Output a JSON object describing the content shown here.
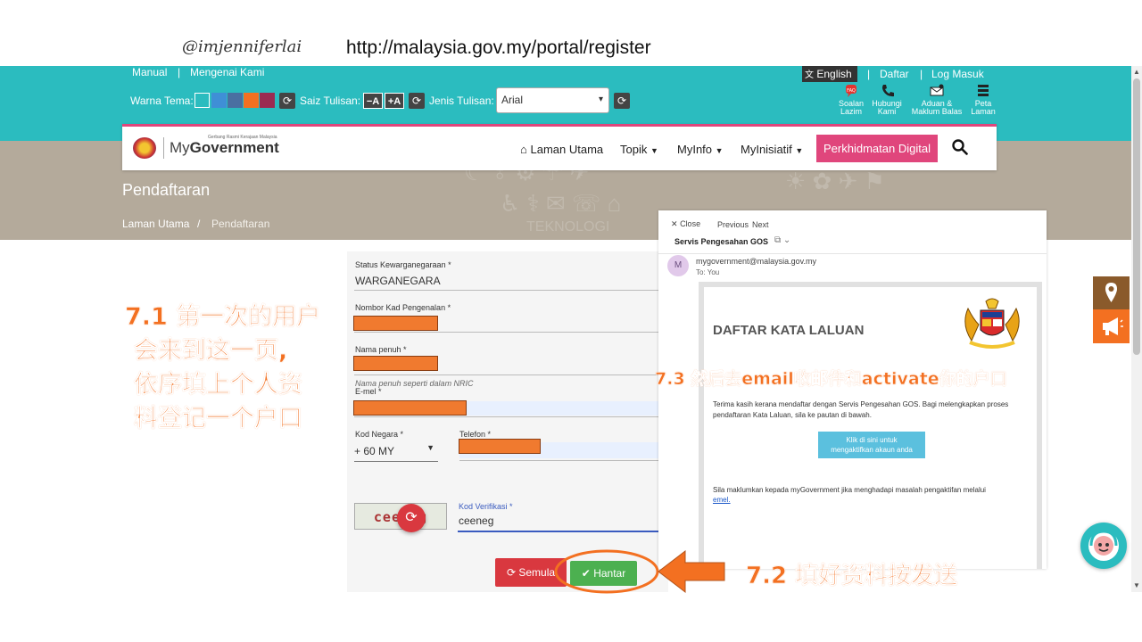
{
  "caption": {
    "handle": "@imjenniferlai",
    "url": "http://malaysia.gov.my/portal/register"
  },
  "topbar": {
    "manual": "Manual",
    "separator": "|",
    "about": "Mengenai Kami",
    "theme_label": "Warna Tema:",
    "theme_colors": [
      "#2bbcbf",
      "#3f8fd6",
      "#4a6fa1",
      "#f37021",
      "#9b2b52"
    ],
    "font_size_label": "Saiz Tulisan:",
    "font_decrease": "−A",
    "font_increase": "+A",
    "font_type_label": "Jenis Tulisan:",
    "font_select_value": "Arial",
    "language": "English",
    "register": "Daftar",
    "login": "Log Masuk",
    "quick_links": [
      {
        "line1": "Soalan",
        "line2": "Lazim",
        "icon": "faq-icon"
      },
      {
        "line1": "Hubungi",
        "line2": "Kami",
        "icon": "phone-icon"
      },
      {
        "line1": "Aduan &",
        "line2": "Maklum Balas",
        "icon": "feedback-icon"
      },
      {
        "line1": "Peta",
        "line2": "Laman",
        "icon": "sitemap-icon"
      }
    ]
  },
  "navbar": {
    "logo_tagline": "Gerbang Rasmi Kerajaan Malaysia",
    "logo_my": "My",
    "logo_gov": "Government",
    "home": "Laman Utama",
    "topics": "Topik",
    "myinfo": "MyInfo",
    "myinisiatif": "MyInisiatif",
    "digital": "Perkhidmatan Digital"
  },
  "banner": {
    "title": "Pendaftaran",
    "doodle_word": "TEKNOLOGI",
    "breadcrumb_home": "Laman Utama",
    "breadcrumb_sep": "/",
    "breadcrumb_current": "Pendaftaran"
  },
  "form": {
    "citizenship_label": "Status Kewarganegaraan *",
    "citizenship_value": "WARGANEGARA",
    "ic_label": "Nombor Kad Pengenalan *",
    "name_label": "Nama penuh *",
    "name_hint": "Nama penuh seperti dalam NRIC",
    "email_label": "E-mel *",
    "country_code_label": "Kod Negara *",
    "country_code_value": "+ 60 MY",
    "phone_label": "Telefon *",
    "captcha_image_text": "ceeneg",
    "captcha_label": "Kod Verifikasi *",
    "captcha_value": "ceeneg",
    "reset": "Semula",
    "submit": "Hantar"
  },
  "email": {
    "close": "Close",
    "previous": "Previous",
    "next": "Next",
    "subject": "Servis Pengesahan GOS",
    "avatar_letter": "M",
    "from": "mygovernment@malaysia.gov.my",
    "to": "To: You",
    "card_title": "DAFTAR KATA LALUAN",
    "body1": "Terima kasih kerana mendaftar dengan Servis Pengesahan GOS. Bagi melengkapkan proses pendaftaran Kata Laluan, sila ke pautan di bawah.",
    "activate_line1": "Klik di sini untuk",
    "activate_line2": "mengaktifkan akaun anda",
    "body2": "Sila maklumkan kepada myGovernment jika menghadapi masalah pengaktifan melalui",
    "body2_link": "emel."
  },
  "annotations": {
    "step71_line1": "7.1 第一次的用户",
    "step71_line2": "会来到这一页,",
    "step71_line3": "依序填上个人资",
    "step71_line4": "料登记一个户口",
    "step72": "7.2 填好资料按发送",
    "step73": "7.3 然后去email收邮件和activate你的户口",
    "accent_color": "#f37021"
  },
  "colors": {
    "teal": "#2bbcbf",
    "pink": "#e0467c",
    "red_button": "#d9383f",
    "green_button": "#4cb050"
  }
}
